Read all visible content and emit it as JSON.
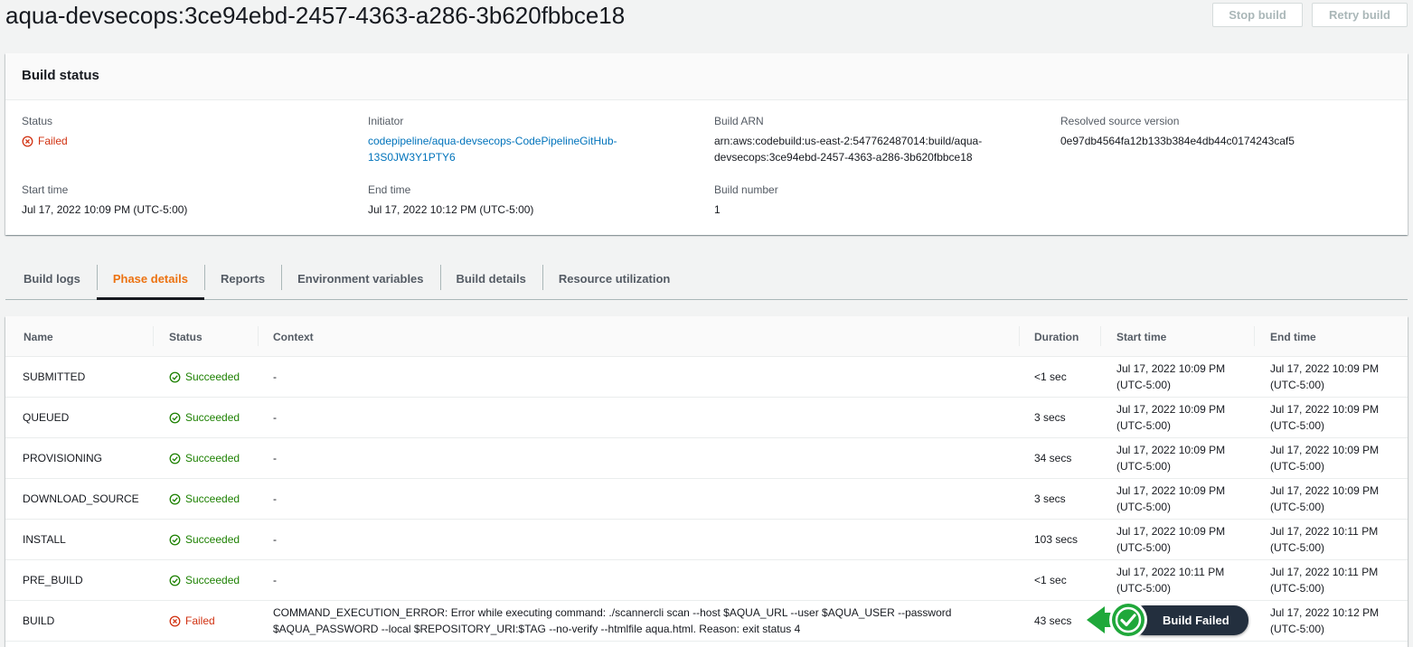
{
  "page": {
    "title": "aqua-devsecops:3ce94ebd-2457-4363-a286-3b620fbbce18",
    "stop_build": "Stop build",
    "retry_build": "Retry build"
  },
  "build_status": {
    "header": "Build status",
    "status_label": "Status",
    "status_value": "Failed",
    "initiator_label": "Initiator",
    "initiator_line1": "codepipeline/aqua-devsecops-CodePipelineGitHub-",
    "initiator_line2": "13S0JW3Y1PTY6",
    "arn_label": "Build ARN",
    "arn_line1": "arn:aws:codebuild:us-east-2:547762487014:build/aqua-",
    "arn_line2": "devsecops:3ce94ebd-2457-4363-a286-3b620fbbce18",
    "source_label": "Resolved source version",
    "source_value": "0e97db4564fa12b133b384e4db44c0174243caf5",
    "start_label": "Start time",
    "start_value": "Jul 17, 2022 10:09 PM (UTC-5:00)",
    "end_label": "End time",
    "end_value": "Jul 17, 2022 10:12 PM (UTC-5:00)",
    "number_label": "Build number",
    "number_value": "1"
  },
  "tabs": [
    {
      "label": "Build logs"
    },
    {
      "label": "Phase details"
    },
    {
      "label": "Reports"
    },
    {
      "label": "Environment variables"
    },
    {
      "label": "Build details"
    },
    {
      "label": "Resource utilization"
    }
  ],
  "phases": {
    "columns": [
      "Name",
      "Status",
      "Context",
      "Duration",
      "Start time",
      "End time"
    ],
    "rows": [
      {
        "name": "SUBMITTED",
        "status": "Succeeded",
        "context": "-",
        "duration": "<1 sec",
        "start1": "Jul 17, 2022 10:09 PM",
        "start2": "(UTC-5:00)",
        "end1": "Jul 17, 2022 10:09 PM",
        "end2": "(UTC-5:00)"
      },
      {
        "name": "QUEUED",
        "status": "Succeeded",
        "context": "-",
        "duration": "3 secs",
        "start1": "Jul 17, 2022 10:09 PM",
        "start2": "(UTC-5:00)",
        "end1": "Jul 17, 2022 10:09 PM",
        "end2": "(UTC-5:00)"
      },
      {
        "name": "PROVISIONING",
        "status": "Succeeded",
        "context": "-",
        "duration": "34 secs",
        "start1": "Jul 17, 2022 10:09 PM",
        "start2": "(UTC-5:00)",
        "end1": "Jul 17, 2022 10:09 PM",
        "end2": "(UTC-5:00)"
      },
      {
        "name": "DOWNLOAD_SOURCE",
        "status": "Succeeded",
        "context": "-",
        "duration": "3 secs",
        "start1": "Jul 17, 2022 10:09 PM",
        "start2": "(UTC-5:00)",
        "end1": "Jul 17, 2022 10:09 PM",
        "end2": "(UTC-5:00)"
      },
      {
        "name": "INSTALL",
        "status": "Succeeded",
        "context": "-",
        "duration": "103 secs",
        "start1": "Jul 17, 2022 10:09 PM",
        "start2": "(UTC-5:00)",
        "end1": "Jul 17, 2022 10:11 PM",
        "end2": "(UTC-5:00)"
      },
      {
        "name": "PRE_BUILD",
        "status": "Succeeded",
        "context": "-",
        "duration": "<1 sec",
        "start1": "Jul 17, 2022 10:11 PM",
        "start2": "(UTC-5:00)",
        "end1": "Jul 17, 2022 10:11 PM",
        "end2": "(UTC-5:00)"
      },
      {
        "name": "BUILD",
        "status": "Failed",
        "context": "COMMAND_EXECUTION_ERROR: Error while executing command: ./scannercli scan --host $AQUA_URL --user $AQUA_USER --password",
        "context2": "$AQUA_PASSWORD --local $REPOSITORY_URI:$TAG --no-verify --htmlfile aqua.html. Reason: exit status 4",
        "duration": "43 secs",
        "start1": "",
        "start2": "",
        "end1": "Jul 17, 2022 10:12 PM",
        "end2": "(UTC-5:00)"
      }
    ]
  },
  "overlay": {
    "label": "Build Failed"
  },
  "colors": {
    "success": "#1d8102",
    "error": "#d13212",
    "link": "#0073bb",
    "active_tab": "#ec7211",
    "overlay_green": "#1fa83a"
  }
}
